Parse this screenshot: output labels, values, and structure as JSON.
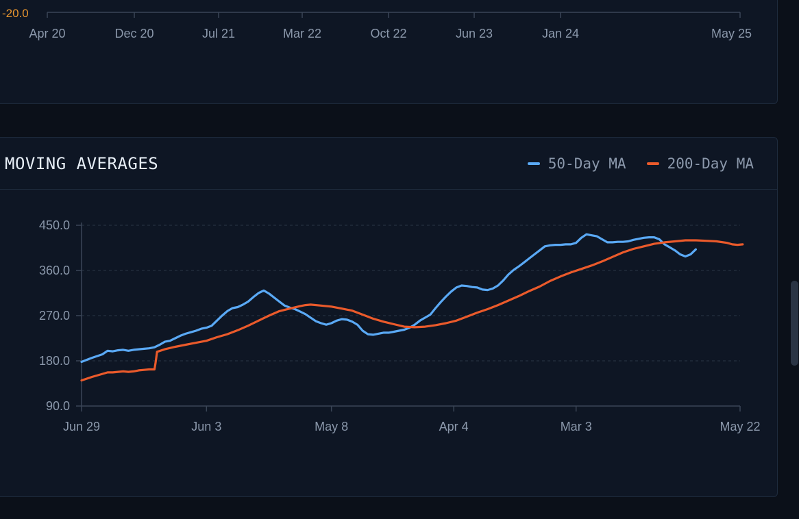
{
  "top_panel": {
    "y_tick_label": "-20.0",
    "y_tick_color": "#e8952f",
    "x_ticks": [
      "Apr 20",
      "Dec 20",
      "Jul 21",
      "Mar 22",
      "Oct 22",
      "Jun 23",
      "Jan 24",
      "May 25"
    ]
  },
  "ma_panel": {
    "title": "MOVING AVERAGES",
    "legend": [
      {
        "label": "50-Day MA",
        "color": "#5aa9f5"
      },
      {
        "label": "200-Day MA",
        "color": "#ea5a2b"
      }
    ]
  },
  "chart_data": {
    "type": "line",
    "title": "MOVING AVERAGES",
    "xlabel": "",
    "ylabel": "",
    "ylim": [
      90,
      450
    ],
    "y_ticks": [
      90,
      180,
      270,
      360,
      450
    ],
    "x_tick_labels": [
      "Jun 29",
      "Jun 3",
      "May 8",
      "Apr 4",
      "Mar 3",
      "May 22"
    ],
    "x_tick_index": [
      0,
      24,
      48,
      71.5,
      95,
      126.5
    ],
    "x_index_range": [
      0,
      126.5
    ],
    "grid": "horizontal dashed",
    "legend_position": "top-right",
    "series": [
      {
        "name": "50-Day MA",
        "color": "#5aa9f5",
        "points": [
          [
            0,
            178
          ],
          [
            2,
            186
          ],
          [
            4,
            193
          ],
          [
            5,
            200
          ],
          [
            6,
            199
          ],
          [
            7,
            201
          ],
          [
            8,
            202
          ],
          [
            9,
            200
          ],
          [
            10,
            202
          ],
          [
            11,
            203
          ],
          [
            12,
            204
          ],
          [
            13,
            205
          ],
          [
            14,
            207
          ],
          [
            15,
            212
          ],
          [
            16,
            218
          ],
          [
            17,
            220
          ],
          [
            18,
            225
          ],
          [
            19,
            230
          ],
          [
            20,
            234
          ],
          [
            21,
            237
          ],
          [
            22,
            240
          ],
          [
            23,
            244
          ],
          [
            24,
            246
          ],
          [
            25,
            250
          ],
          [
            26,
            260
          ],
          [
            27,
            270
          ],
          [
            28,
            279
          ],
          [
            29,
            285
          ],
          [
            30,
            287
          ],
          [
            31,
            292
          ],
          [
            32,
            298
          ],
          [
            33,
            307
          ],
          [
            34,
            315
          ],
          [
            35,
            320
          ],
          [
            36,
            314
          ],
          [
            37,
            306
          ],
          [
            38,
            298
          ],
          [
            39,
            290
          ],
          [
            40,
            286
          ],
          [
            41,
            283
          ],
          [
            42,
            278
          ],
          [
            43,
            273
          ],
          [
            44,
            266
          ],
          [
            45,
            259
          ],
          [
            46,
            255
          ],
          [
            47,
            252
          ],
          [
            48,
            255
          ],
          [
            49,
            260
          ],
          [
            50,
            263
          ],
          [
            51,
            262
          ],
          [
            52,
            258
          ],
          [
            53,
            252
          ],
          [
            54,
            240
          ],
          [
            55,
            233
          ],
          [
            56,
            232
          ],
          [
            57,
            234
          ],
          [
            58,
            236
          ],
          [
            59,
            236
          ],
          [
            60,
            238
          ],
          [
            61,
            240
          ],
          [
            62,
            242
          ],
          [
            63,
            246
          ],
          [
            64,
            252
          ],
          [
            65,
            260
          ],
          [
            66,
            266
          ],
          [
            67,
            272
          ],
          [
            68,
            285
          ],
          [
            69,
            297
          ],
          [
            70,
            308
          ],
          [
            71,
            318
          ],
          [
            72,
            326
          ],
          [
            73,
            330
          ],
          [
            74,
            329
          ],
          [
            75,
            327
          ],
          [
            76,
            326
          ],
          [
            77,
            322
          ],
          [
            78,
            321
          ],
          [
            79,
            324
          ],
          [
            80,
            330
          ],
          [
            81,
            340
          ],
          [
            82,
            352
          ],
          [
            83,
            361
          ],
          [
            84,
            368
          ],
          [
            85,
            376
          ],
          [
            86,
            384
          ],
          [
            87,
            392
          ],
          [
            88,
            400
          ],
          [
            89,
            408
          ],
          [
            90,
            410
          ],
          [
            91,
            411
          ],
          [
            92,
            411
          ],
          [
            93,
            412
          ],
          [
            94,
            412
          ],
          [
            95,
            415
          ],
          [
            96,
            425
          ],
          [
            97,
            432
          ],
          [
            98,
            430
          ],
          [
            99,
            428
          ],
          [
            100,
            422
          ],
          [
            101,
            416
          ],
          [
            102,
            416
          ],
          [
            103,
            417
          ],
          [
            104,
            417
          ],
          [
            105,
            418
          ],
          [
            106,
            421
          ],
          [
            107,
            423
          ],
          [
            108,
            425
          ],
          [
            109,
            426
          ],
          [
            110,
            426
          ],
          [
            111,
            422
          ],
          [
            112,
            412
          ],
          [
            113,
            406
          ],
          [
            114,
            400
          ],
          [
            115,
            392
          ],
          [
            116,
            388
          ],
          [
            117,
            392
          ],
          [
            118,
            402
          ]
        ]
      },
      {
        "name": "200-Day MA",
        "color": "#ea5a2b",
        "points": [
          [
            0,
            141
          ],
          [
            2,
            148
          ],
          [
            4,
            154
          ],
          [
            5,
            157
          ],
          [
            6,
            157
          ],
          [
            7,
            158
          ],
          [
            8,
            159
          ],
          [
            9,
            158
          ],
          [
            10,
            159
          ],
          [
            11,
            161
          ],
          [
            12,
            162
          ],
          [
            13,
            163
          ],
          [
            14,
            163
          ],
          [
            14.2,
            175
          ],
          [
            14.5,
            198
          ],
          [
            16,
            203
          ],
          [
            18,
            208
          ],
          [
            20,
            212
          ],
          [
            22,
            216
          ],
          [
            24,
            220
          ],
          [
            26,
            227
          ],
          [
            28,
            233
          ],
          [
            30,
            241
          ],
          [
            32,
            250
          ],
          [
            34,
            260
          ],
          [
            36,
            270
          ],
          [
            38,
            279
          ],
          [
            40,
            284
          ],
          [
            42,
            289
          ],
          [
            43,
            291
          ],
          [
            44,
            292
          ],
          [
            46,
            290
          ],
          [
            48,
            288
          ],
          [
            50,
            284
          ],
          [
            52,
            280
          ],
          [
            54,
            272
          ],
          [
            56,
            264
          ],
          [
            58,
            258
          ],
          [
            60,
            253
          ],
          [
            62,
            248
          ],
          [
            64,
            247
          ],
          [
            66,
            248
          ],
          [
            68,
            251
          ],
          [
            70,
            255
          ],
          [
            72,
            260
          ],
          [
            74,
            268
          ],
          [
            76,
            276
          ],
          [
            78,
            283
          ],
          [
            80,
            291
          ],
          [
            82,
            300
          ],
          [
            84,
            309
          ],
          [
            86,
            319
          ],
          [
            88,
            328
          ],
          [
            90,
            339
          ],
          [
            92,
            348
          ],
          [
            94,
            356
          ],
          [
            96,
            363
          ],
          [
            98,
            370
          ],
          [
            100,
            378
          ],
          [
            102,
            387
          ],
          [
            104,
            396
          ],
          [
            106,
            403
          ],
          [
            108,
            408
          ],
          [
            110,
            413
          ],
          [
            112,
            416
          ],
          [
            114,
            418
          ],
          [
            116,
            420
          ],
          [
            118,
            420
          ],
          [
            120,
            419
          ],
          [
            122,
            418
          ],
          [
            124,
            415
          ],
          [
            125,
            412
          ],
          [
            126,
            411
          ],
          [
            127,
            412
          ]
        ]
      }
    ]
  }
}
